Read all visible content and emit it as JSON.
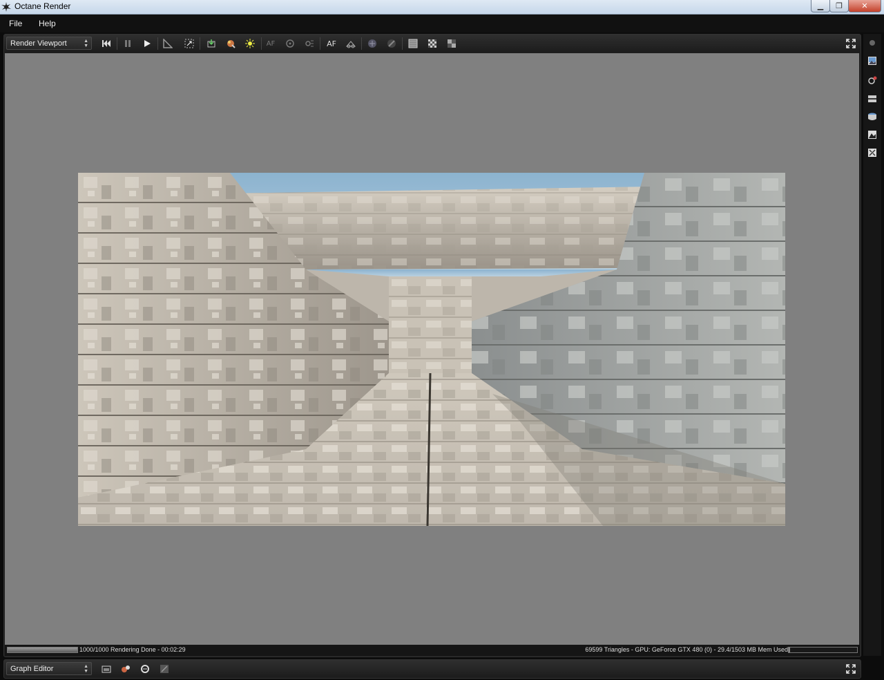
{
  "window": {
    "title": "Octane Render",
    "controls": {
      "minimize": "minimize-icon",
      "maximize": "maximize-icon",
      "close": "close-icon"
    }
  },
  "menu": {
    "items": [
      "File",
      "Help"
    ]
  },
  "viewport_toolbar": {
    "mode_dropdown": "Render Viewport",
    "buttons": [
      {
        "name": "restart-icon"
      },
      {
        "name": "pause-icon"
      },
      {
        "name": "play-icon"
      },
      {
        "name": "recenter-icon"
      },
      {
        "name": "zoom-fit-icon"
      },
      {
        "name": "export-icon"
      },
      {
        "name": "material-picker-icon"
      },
      {
        "name": "light-picker-icon"
      },
      {
        "name": "autofocus-picker-icon",
        "label": "AF"
      },
      {
        "name": "white-balance-icon"
      },
      {
        "name": "focus-picker-icon"
      },
      {
        "name": "autofocus-icon",
        "label": "AF"
      },
      {
        "name": "camera-icon"
      },
      {
        "name": "lock-resolution-icon"
      },
      {
        "name": "region-icon"
      },
      {
        "name": "clay-mode-icon"
      },
      {
        "name": "subsample-icon"
      },
      {
        "name": "alpha-icon"
      }
    ]
  },
  "status": {
    "progress_fraction": 1.0,
    "left_text": "1000/1000 Rendering Done - 00:02:29",
    "right_text": "69599 Triangles - GPU: GeForce GTX 480 (0) - 29.4/1503 MB Mem Used",
    "mem_fraction": 0.02
  },
  "graph_toolbar": {
    "mode_dropdown": "Graph Editor"
  },
  "colors": {
    "viewport_bg": "#808080",
    "panel_bg": "#1e1e1e",
    "accent": "#c5412b"
  }
}
